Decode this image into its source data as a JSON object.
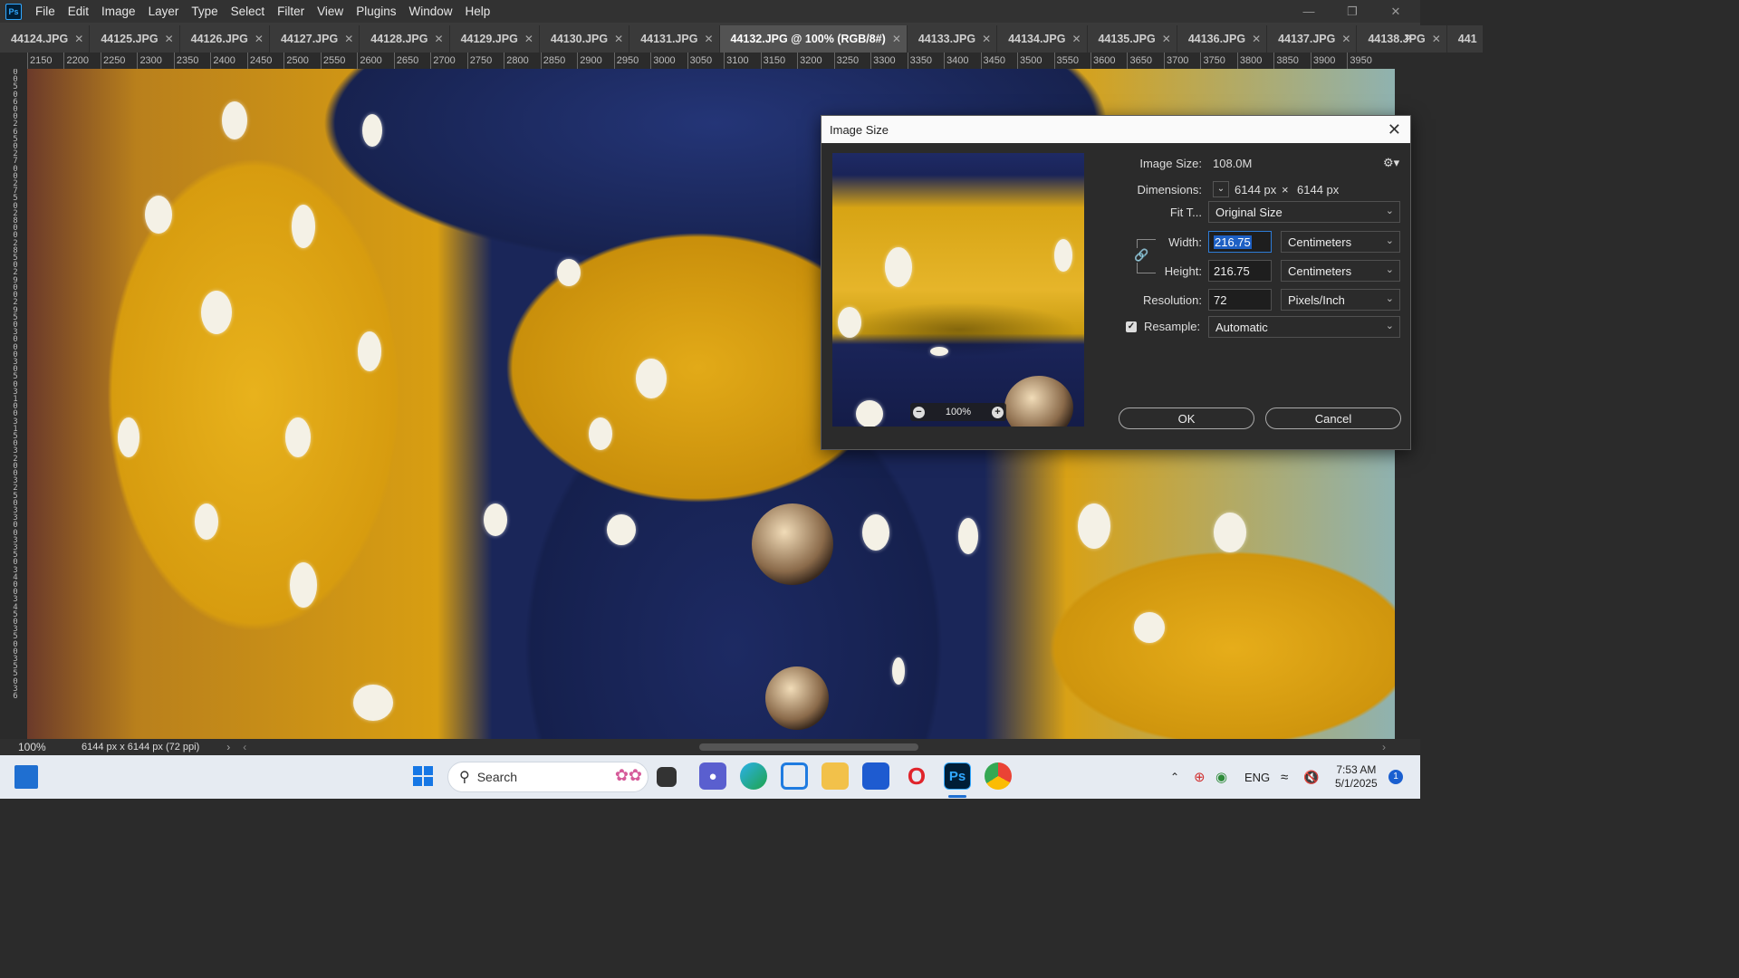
{
  "app": {
    "logo": "Ps",
    "menu": [
      "File",
      "Edit",
      "Image",
      "Layer",
      "Type",
      "Select",
      "Filter",
      "View",
      "Plugins",
      "Window",
      "Help"
    ]
  },
  "tabs": [
    {
      "label": "44124.JPG"
    },
    {
      "label": "44125.JPG"
    },
    {
      "label": "44126.JPG"
    },
    {
      "label": "44127.JPG"
    },
    {
      "label": "44128.JPG"
    },
    {
      "label": "44129.JPG"
    },
    {
      "label": "44130.JPG"
    },
    {
      "label": "44131.JPG"
    },
    {
      "label": "44132.JPG @ 100% (RGB/8#)"
    },
    {
      "label": "44133.JPG"
    },
    {
      "label": "44134.JPG"
    },
    {
      "label": "44135.JPG"
    },
    {
      "label": "44136.JPG"
    },
    {
      "label": "44137.JPG"
    },
    {
      "label": "44138.JPG"
    },
    {
      "label": "441"
    }
  ],
  "ruler": {
    "h_ticks": [
      "2150",
      "2200",
      "2250",
      "2300",
      "2350",
      "2400",
      "2450",
      "2500",
      "2550",
      "2600",
      "2650",
      "2700",
      "2750",
      "2800",
      "2850",
      "2900",
      "2950",
      "3000",
      "3050",
      "3100",
      "3150",
      "3200",
      "3250",
      "3300",
      "3350",
      "3400",
      "3450",
      "3500",
      "3550",
      "3600",
      "3650",
      "3700",
      "3750",
      "3800",
      "3850",
      "3900",
      "3950"
    ],
    "v_ticks": "0\n0\n5\n0\n6\n0\n0\n2\n6\n5\n0\n2\n7\n0\n0\n2\n7\n5\n0\n2\n8\n0\n0\n2\n8\n5\n0\n2\n9\n0\n0\n2\n9\n5\n0\n3\n0\n0\n0\n3\n0\n5\n0\n3\n1\n0\n0\n3\n1\n5\n0\n3\n2\n0\n0\n3\n2\n5\n0\n3\n3\n0\n0\n3\n3\n5\n0\n3\n4\n0\n0\n3\n4\n5\n0\n3\n5\n0\n0\n3\n5\n5\n0\n3\n6"
  },
  "status": {
    "zoom": "100%",
    "doc_info": "6144 px x 6144 px (72 ppi)"
  },
  "dialog": {
    "title": "Image Size",
    "image_size_label": "Image Size:",
    "image_size_value": "108.0M",
    "dimensions_label": "Dimensions:",
    "dim_w": "6144 px",
    "dim_x": "×",
    "dim_h": "6144 px",
    "fit_label": "Fit T...",
    "fit_value": "Original Size",
    "width_label": "Width:",
    "width_value": "216.75",
    "width_unit": "Centimeters",
    "height_label": "Height:",
    "height_value": "216.75",
    "height_unit": "Centimeters",
    "resolution_label": "Resolution:",
    "resolution_value": "72",
    "resolution_unit": "Pixels/Inch",
    "resample_label": "Resample:",
    "resample_value": "Automatic",
    "preview_zoom": "100%",
    "ok": "OK",
    "cancel": "Cancel"
  },
  "taskbar": {
    "search": "Search",
    "lang": "ENG",
    "time": "7:53 AM",
    "date": "5/1/2025",
    "notifications": "1"
  }
}
